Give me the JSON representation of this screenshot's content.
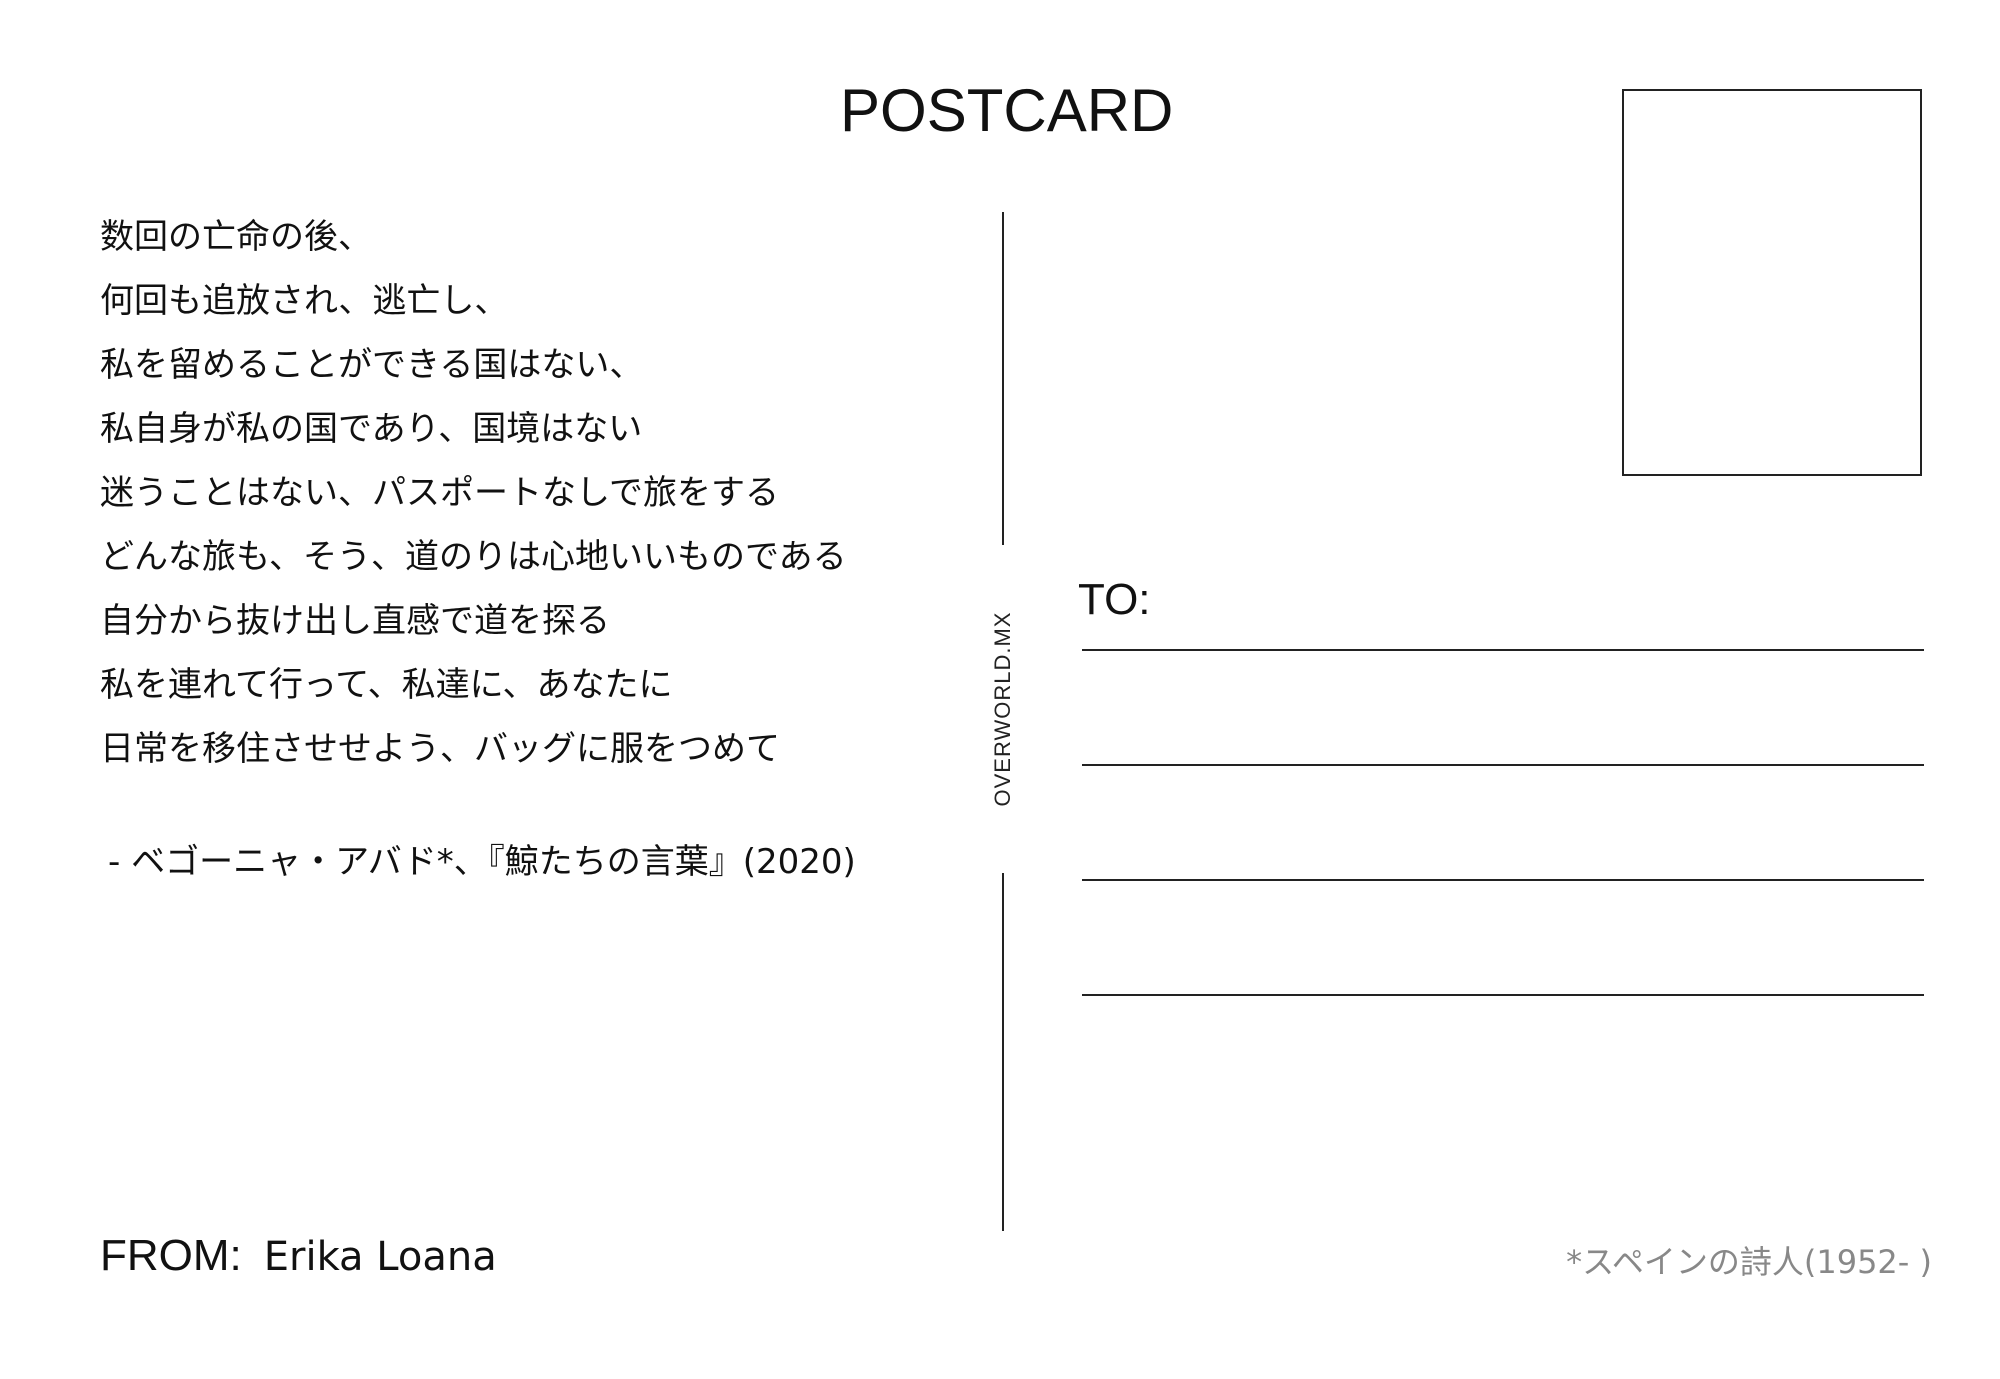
{
  "card": {
    "title": "POSTCARD",
    "brand_vertical": "OVERWORLD.MX",
    "poem_lines": [
      "数回の亡命の後、",
      "何回も追放され、逃亡し、",
      "私を留めることができる国はない、",
      "私自身が私の国であり、国境はない",
      "迷うことはない、パスポートなしで旅をする",
      "どんな旅も、そう、道のりは心地いいものである",
      "自分から抜け出し直感で道を探る",
      "私を連れて行って、私達に、あなたに",
      "日常を移住させせよう、バッグに服をつめて"
    ],
    "attribution": "- ベゴーニャ・アバド*、『鯨たちの言葉』(2020)",
    "to_label": "TO:",
    "from_label": "FROM:",
    "from_name": "Erika Loana",
    "footnote": "*スペインの詩人(1952- )"
  }
}
